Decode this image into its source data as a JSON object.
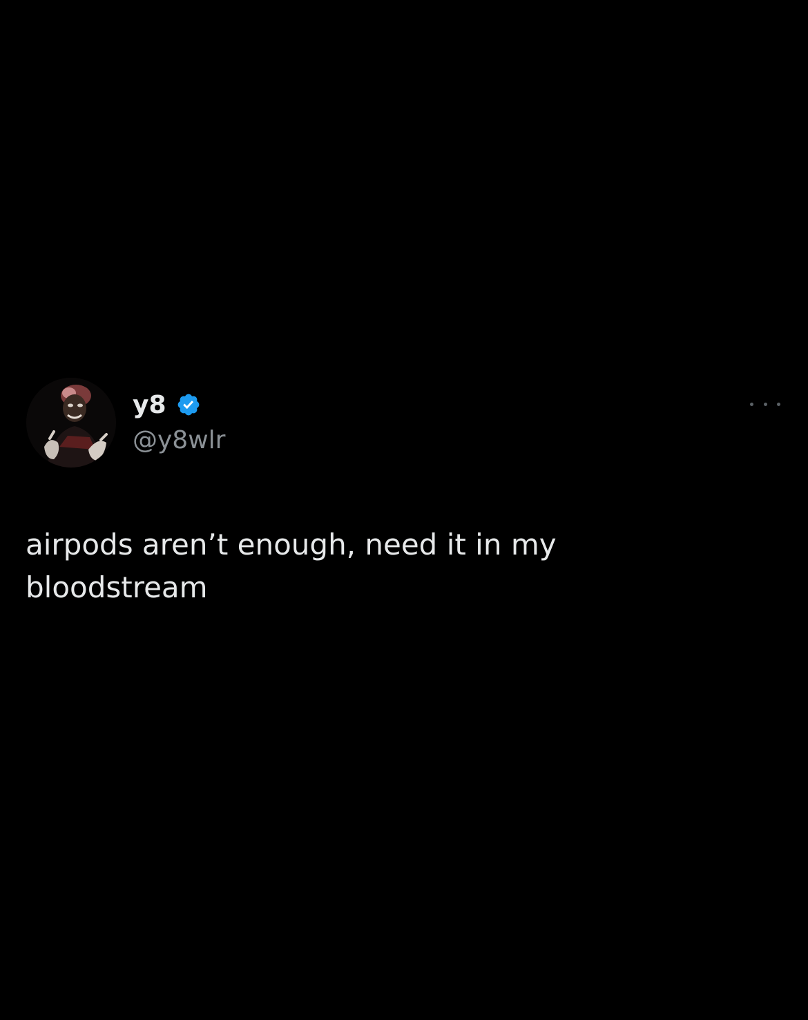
{
  "tweet": {
    "author": {
      "display_name": "y8",
      "handle": "@y8wlr",
      "verified": true,
      "verified_color": "#1d9bf0",
      "avatar_icon": "avatar-photo"
    },
    "text": "airpods aren’t enough, need it in my\nbloodstream",
    "more_icon": "ellipsis-icon"
  },
  "colors": {
    "background": "#000000",
    "primary_text": "#e7e9ea",
    "secondary_text": "#8b9196"
  }
}
